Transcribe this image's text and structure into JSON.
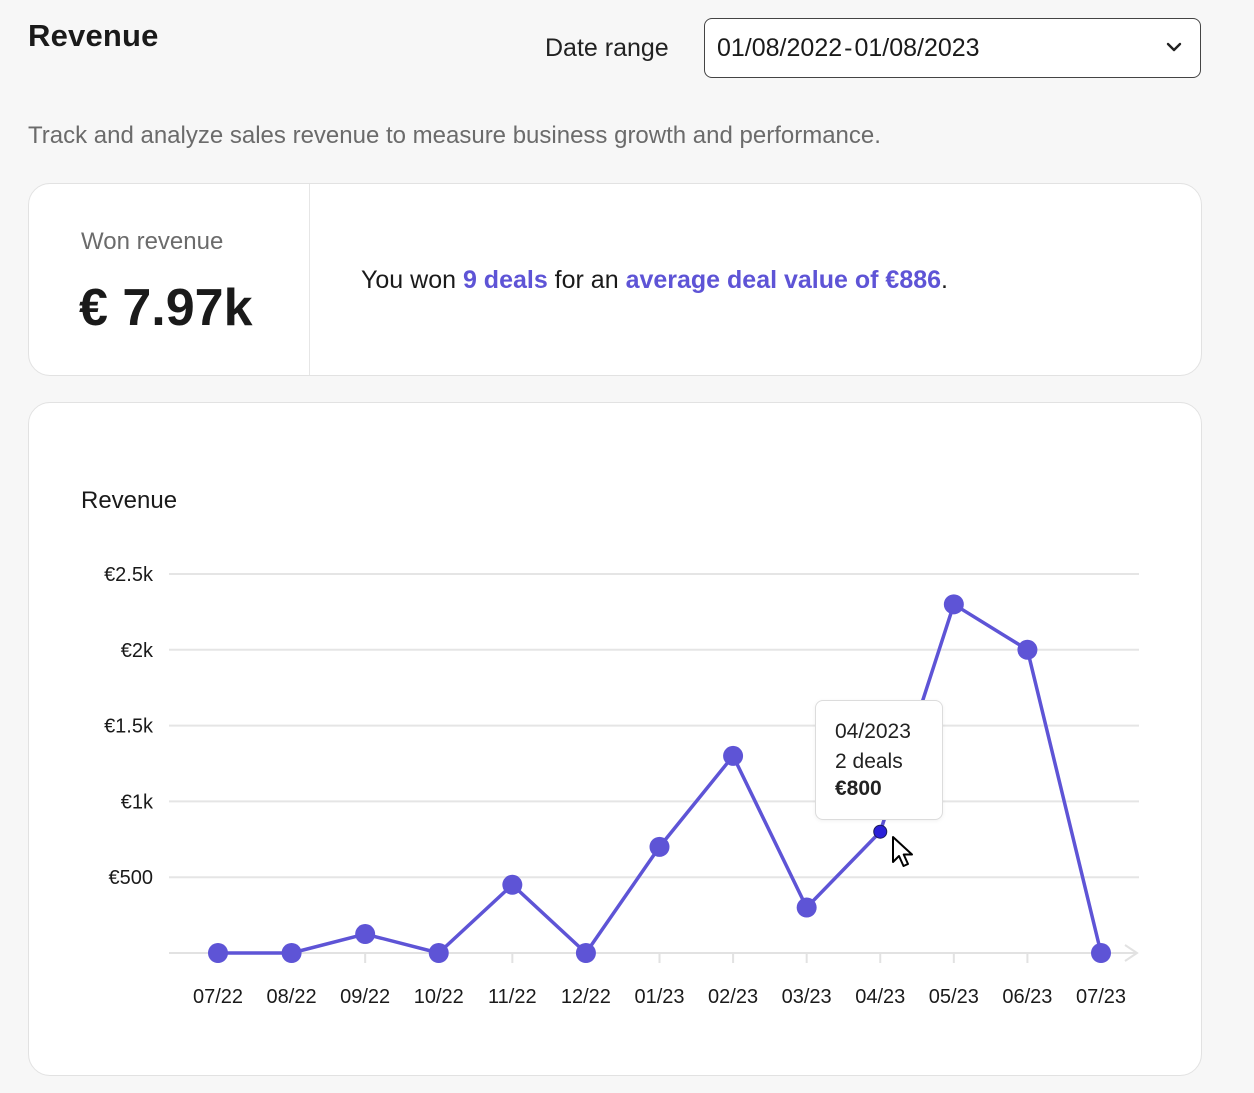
{
  "header": {
    "title": "Revenue",
    "date_range_label": "Date range",
    "date_range": {
      "start": "01/08/2022",
      "separator": "-",
      "end": "01/08/2023"
    },
    "subtitle": "Track and analyze sales revenue to measure business growth and performance."
  },
  "summary": {
    "won_label": "Won revenue",
    "won_value": "€ 7.97k",
    "text_pre": "You won ",
    "deals_link": "9 deals",
    "text_mid": " for an ",
    "average_link": "average deal value of €886",
    "text_post": "."
  },
  "tooltip": {
    "month": "04/2023",
    "deals": "2 deals",
    "value": "€800"
  },
  "colors": {
    "accent": "#5e54d6",
    "highlight_point": "#2a1fd8",
    "grid": "#e5e5e5"
  },
  "chart_data": {
    "type": "line",
    "title": "Revenue",
    "categories": [
      "07/22",
      "08/22",
      "09/22",
      "10/22",
      "11/22",
      "12/22",
      "01/23",
      "02/23",
      "03/23",
      "04/23",
      "05/23",
      "06/23",
      "07/23"
    ],
    "values": [
      0,
      0,
      125,
      0,
      450,
      0,
      700,
      1300,
      300,
      800,
      2300,
      2000,
      0
    ],
    "ylim": [
      0,
      2500
    ],
    "y_ticks": [
      500,
      1000,
      1500,
      2000,
      2500
    ],
    "y_tick_labels": [
      "€500",
      "€1k",
      "€1.5k",
      "€2k",
      "€2.5k"
    ],
    "grid": true,
    "highlighted_index": 9
  }
}
